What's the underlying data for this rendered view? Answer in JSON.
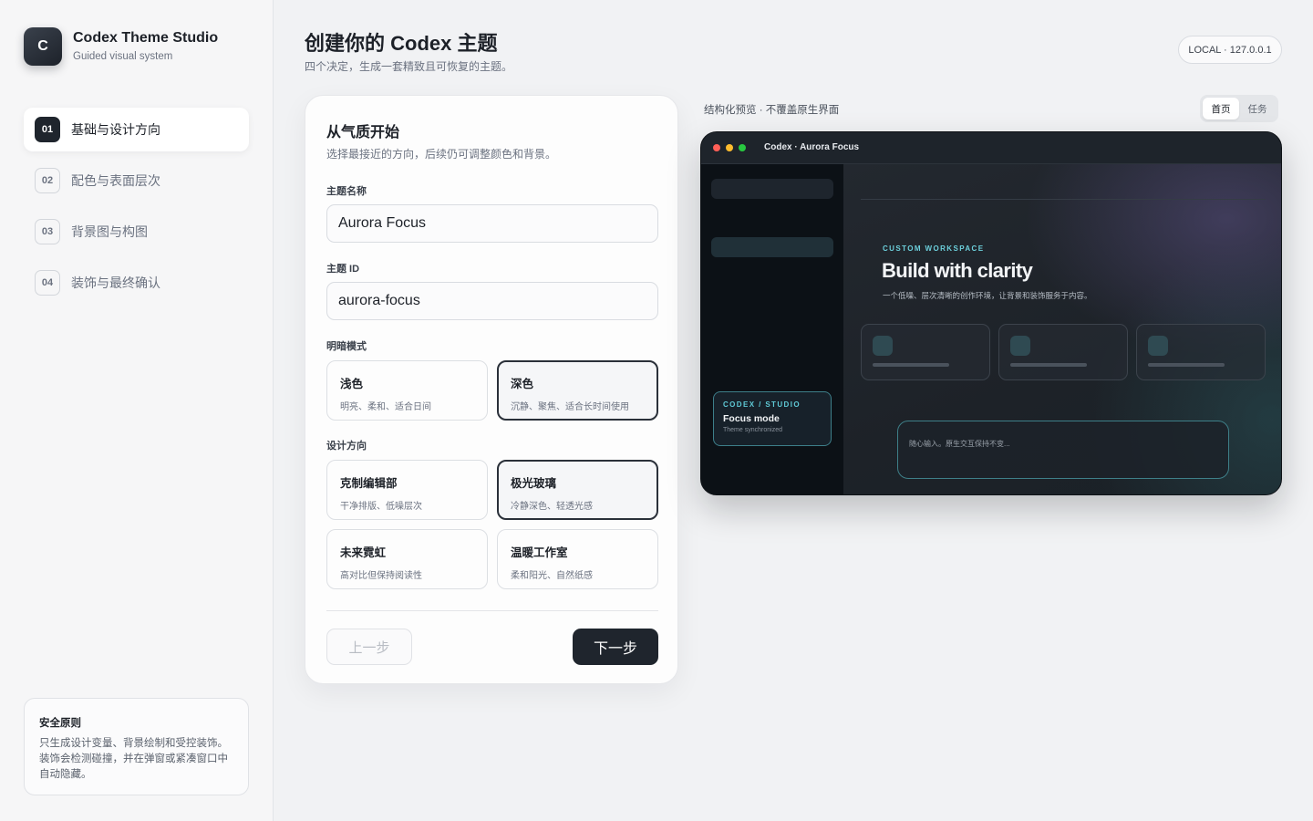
{
  "brand": {
    "logo_letter": "C",
    "title": "Codex Theme Studio",
    "subtitle": "Guided visual system"
  },
  "steps": [
    {
      "num": "01",
      "label": "基础与设计方向",
      "active": true
    },
    {
      "num": "02",
      "label": "配色与表面层次",
      "active": false
    },
    {
      "num": "03",
      "label": "背景图与构图",
      "active": false
    },
    {
      "num": "04",
      "label": "装饰与最终确认",
      "active": false
    }
  ],
  "safety": {
    "title": "安全原则",
    "body": "只生成设计变量、背景绘制和受控装饰。装饰会检测碰撞，并在弹窗或紧凑窗口中自动隐藏。"
  },
  "header": {
    "title": "创建你的 Codex 主题",
    "subtitle": "四个决定，生成一套精致且可恢复的主题。",
    "badge": "LOCAL · 127.0.0.1"
  },
  "form": {
    "title": "从气质开始",
    "subtitle": "选择最接近的方向，后续仍可调整颜色和背景。",
    "name_label": "主题名称",
    "name_value": "Aurora Focus",
    "id_label": "主题 ID",
    "id_value": "aurora-focus",
    "mode_label": "明暗模式",
    "modes": [
      {
        "title": "浅色",
        "desc": "明亮、柔和、适合日间",
        "selected": false
      },
      {
        "title": "深色",
        "desc": "沉静、聚焦、适合长时间使用",
        "selected": true
      }
    ],
    "direction_label": "设计方向",
    "directions": [
      {
        "title": "克制编辑部",
        "desc": "干净排版、低噪层次",
        "selected": false
      },
      {
        "title": "极光玻璃",
        "desc": "冷静深色、轻透光感",
        "selected": true
      },
      {
        "title": "未来霓虹",
        "desc": "高对比但保持阅读性",
        "selected": false
      },
      {
        "title": "温暖工作室",
        "desc": "柔和阳光、自然纸感",
        "selected": false
      }
    ],
    "prev_label": "上一步",
    "next_label": "下一步"
  },
  "preview": {
    "label": "结构化预览 · 不覆盖原生界面",
    "tabs": [
      {
        "label": "首页",
        "active": true
      },
      {
        "label": "任务",
        "active": false
      }
    ],
    "window_title": "Codex · Aurora Focus",
    "eyebrow": "CUSTOM WORKSPACE",
    "headline": "Build with clarity",
    "description": "一个低噪、层次清晰的创作环境，让背景和装饰服务于内容。",
    "mini_card": {
      "eyebrow": "CODEX / STUDIO",
      "title": "Focus mode",
      "subtitle": "Theme synchronized"
    },
    "input_placeholder": "随心输入。原生交互保持不变..."
  },
  "colors": {
    "accent_dark": "#1f252d",
    "preview_cyan": "#6cd0dc",
    "traffic_red": "#ff5f57",
    "traffic_yellow": "#febc2e",
    "traffic_green": "#28c840"
  }
}
